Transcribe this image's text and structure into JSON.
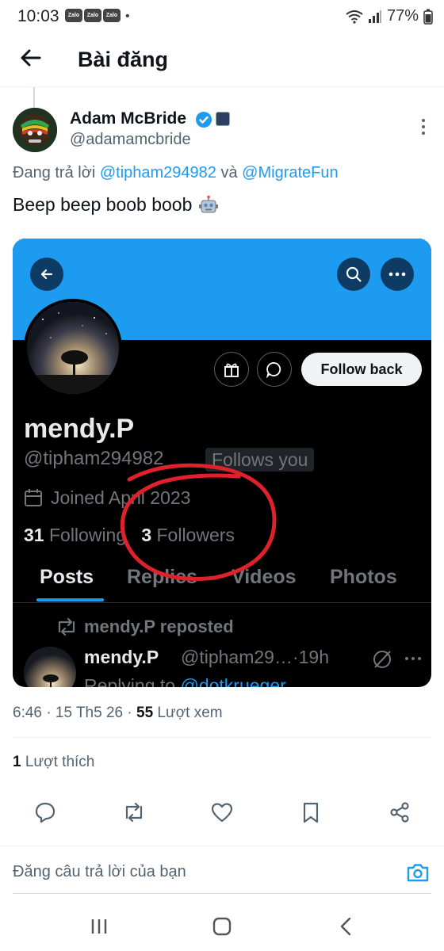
{
  "status_bar": {
    "time": "10:03",
    "zalo_label": "Zalo",
    "battery": "77%"
  },
  "header": {
    "title": "Bài đăng"
  },
  "post": {
    "author_name": "Adam McBride",
    "author_handle": "@adamamcbride",
    "reply_prefix": "Đang trả lời",
    "reply_user_1": "@tipham294982",
    "reply_joiner": "và",
    "reply_user_2": "@MigrateFun",
    "text": "Beep beep boob boob",
    "time": "6:46",
    "date": "15 Th5 26",
    "views_count": "55",
    "views_label": "Lượt xem",
    "likes_count": "1",
    "likes_label": "Lượt thích"
  },
  "embedded_profile": {
    "follow_button": "Follow back",
    "name": "mendy.P",
    "handle": "@tipham294982",
    "follows_you": "Follows you",
    "joined": "Joined April 2023",
    "following_count": "31",
    "following_label": "Following",
    "followers_count": "3",
    "followers_label": "Followers",
    "tabs": [
      "Posts",
      "Replies",
      "Videos",
      "Photos"
    ],
    "reposted_label": "mendy.P reposted",
    "post_name": "mendy.P",
    "post_meta": "@tipham29…·19h",
    "post_reply_prefix": "Replying to",
    "post_reply_user": "@dotkrueger"
  },
  "reply_box": {
    "placeholder": "Đăng câu trả lời của bạn"
  },
  "colors": {
    "accent": "#1d9bf0",
    "annotation": "#e0202a"
  }
}
